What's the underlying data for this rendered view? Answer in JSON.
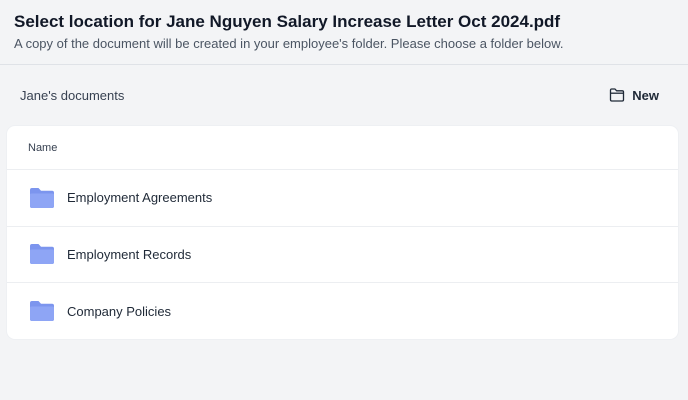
{
  "header": {
    "title": "Select location for Jane Nguyen Salary Increase Letter Oct 2024.pdf",
    "subtitle": "A copy of the document will be created in your employee's folder. Please choose a folder below."
  },
  "location": {
    "label": "Jane's documents",
    "new_button_label": "New",
    "new_button_icon": "folder-outline-icon"
  },
  "table": {
    "column_name": "Name",
    "rows": [
      {
        "label": "Employment Agreements",
        "icon": "folder-icon"
      },
      {
        "label": "Employment Records",
        "icon": "folder-icon"
      },
      {
        "label": "Company Policies",
        "icon": "folder-icon"
      }
    ]
  },
  "colors": {
    "folder_icon": "#8ea5f5",
    "folder_icon_tab": "#7c95ee",
    "background": "#f3f4f6",
    "card": "#ffffff"
  }
}
